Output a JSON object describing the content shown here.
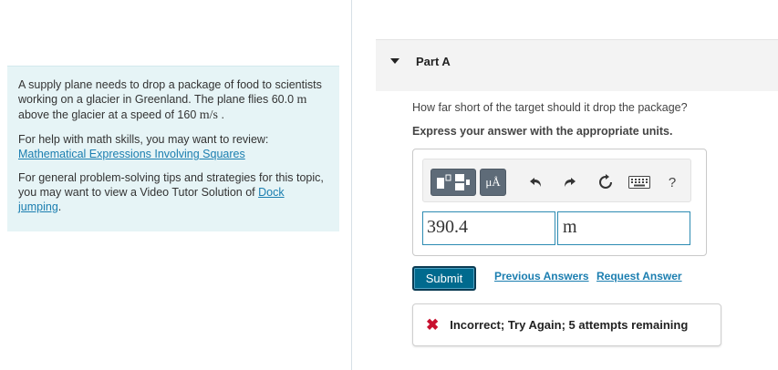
{
  "problem": {
    "text_before": "A supply plane needs to drop a package of food to scientists working on a glacier in Greenland. The plane flies 60.0 ",
    "unit_m": "m",
    "text_middle": " above the glacier at a speed of 160 ",
    "unit_ms": "m/s",
    "text_end": " .",
    "help_intro": "For help with math skills, you may want to review:",
    "help_link": "Mathematical Expressions Involving Squares",
    "tips_text": "For general problem-solving tips and strategies for this topic, you may want to view a Video Tutor Solution of",
    "tips_link": "Dock jumping",
    "tips_end": "."
  },
  "part": {
    "title": "Part A",
    "question": "How far short of the target should it drop the package?",
    "instruction": "Express your answer with the appropriate units."
  },
  "toolbar": {
    "units_label": "μÅ",
    "help_label": "?",
    "icons": [
      "templates-icon",
      "units-icon",
      "undo-icon",
      "redo-icon",
      "reset-icon",
      "keyboard-icon",
      "help-icon"
    ]
  },
  "answer": {
    "value": "390.4",
    "unit": "m"
  },
  "actions": {
    "submit": "Submit",
    "previous_answers": "Previous Answers",
    "request_answer": "Request Answer"
  },
  "feedback": {
    "icon": "x-icon",
    "text": "Incorrect; Try Again; 5 attempts remaining",
    "color": "#c8102e"
  },
  "colors": {
    "problem_bg": "#e6f4f6",
    "link": "#1b7eb0",
    "submit_bg": "#006a8e",
    "input_border": "#2d8bb2"
  }
}
